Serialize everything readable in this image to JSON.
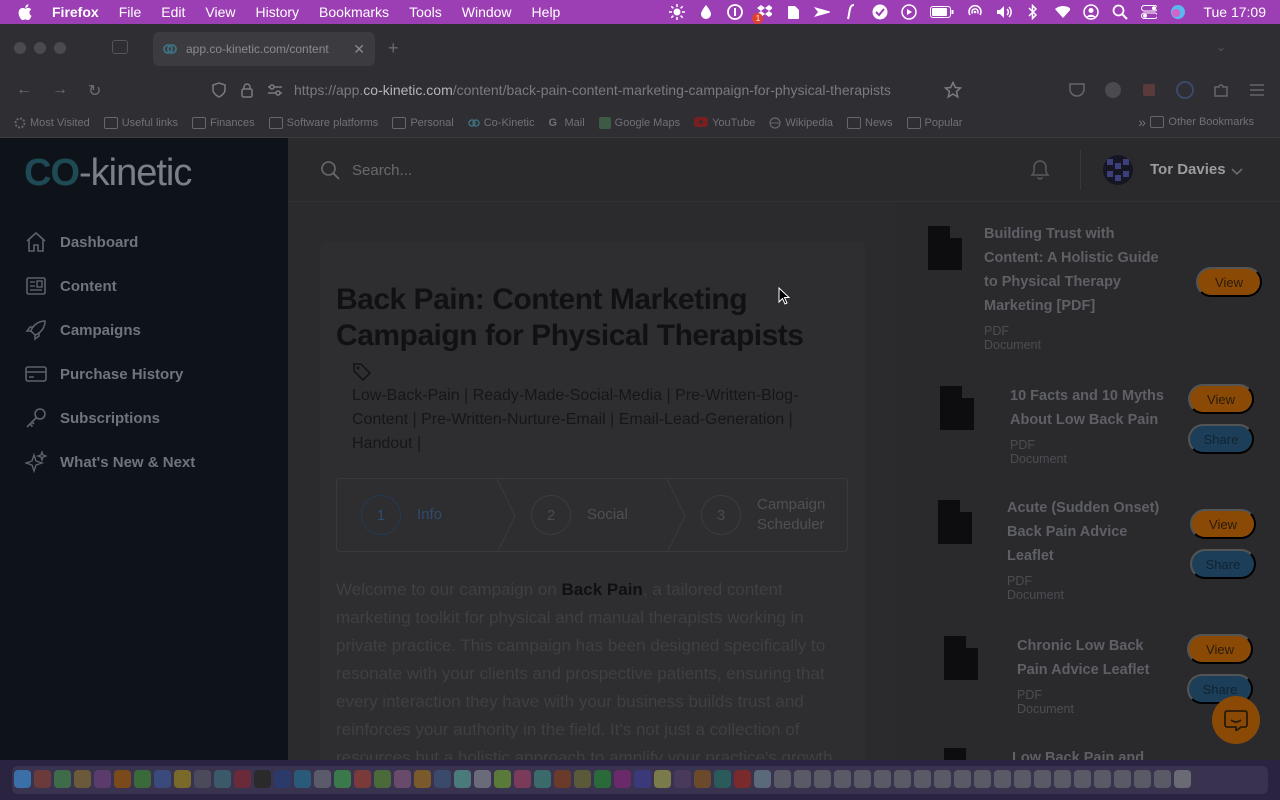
{
  "menubar": {
    "app": "Firefox",
    "items": [
      "File",
      "Edit",
      "View",
      "History",
      "Bookmarks",
      "Tools",
      "Window",
      "Help"
    ],
    "badge": "1",
    "clock": "Tue  17:09"
  },
  "browser": {
    "tab_title": "app.co-kinetic.com/content",
    "url_prefix": "https://app.",
    "url_domain": "co-kinetic.com",
    "url_path": "/content/back-pain-content-marketing-campaign-for-physical-therapists",
    "bookmarks": [
      "Most Visited",
      "Useful links",
      "Finances",
      "Software platforms",
      "Personal",
      "Co-Kinetic",
      "Mail",
      "Google Maps",
      "YouTube",
      "Wikipedia",
      "News",
      "Popular"
    ],
    "other_bookmarks": "Other Bookmarks"
  },
  "app": {
    "logo_co": "CO",
    "logo_rest": "-kinetic",
    "nav": [
      {
        "label": "Dashboard",
        "icon": "home-icon"
      },
      {
        "label": "Content",
        "icon": "content-icon"
      },
      {
        "label": "Campaigns",
        "icon": "rocket-icon"
      },
      {
        "label": "Purchase History",
        "icon": "credit-card-icon"
      },
      {
        "label": "Subscriptions",
        "icon": "key-icon"
      },
      {
        "label": "What's New & Next",
        "icon": "sparkle-icon"
      }
    ],
    "search_placeholder": "Search...",
    "user_name": "Tor Davies"
  },
  "page": {
    "title": "Back Pain: Content Marketing Campaign for Physical Therapists",
    "tags": "Low-Back-Pain | Ready-Made-Social-Media | Pre-Written-Blog-Content | Pre-Written-Nurture-Email | Email-Lead-Generation | Handout |",
    "steps": [
      {
        "num": "1",
        "label": "Info"
      },
      {
        "num": "2",
        "label": "Social"
      },
      {
        "num": "3",
        "label": "Campaign Scheduler"
      }
    ],
    "body_pre": "Welcome to our campaign on ",
    "body_bold": "Back Pain",
    "body_post": ", a tailored content marketing toolkit for physical and manual therapists working in private practice. This campaign has been designed specifically to resonate with your clients and prospective patients, ensuring that every interaction they have with your business builds trust and reinforces your authority in the field. It's not just a collection of resources but a holistic approach to amplify your practice's growth."
  },
  "resources": {
    "view_label": "View",
    "share_label": "Share",
    "items": [
      {
        "title": "Building Trust with Content: A Holistic Guide to Physical Therapy Marketing [PDF]",
        "type": "PDF Document"
      },
      {
        "title": "10 Facts and 10 Myths About Low Back Pain",
        "type": "PDF Document"
      },
      {
        "title": "Acute (Sudden Onset) Back Pain Advice Leaflet",
        "type": "PDF Document"
      },
      {
        "title": "Chronic Low Back Pain Advice Leaflet",
        "type": "PDF Document"
      },
      {
        "title": "Low Back Pain and",
        "type": ""
      }
    ]
  },
  "colors": {
    "menubar": "#9c3fb4",
    "view_button": "#8a4a06",
    "share_button": "#1d3e58",
    "sidebar": "#0e131a"
  }
}
